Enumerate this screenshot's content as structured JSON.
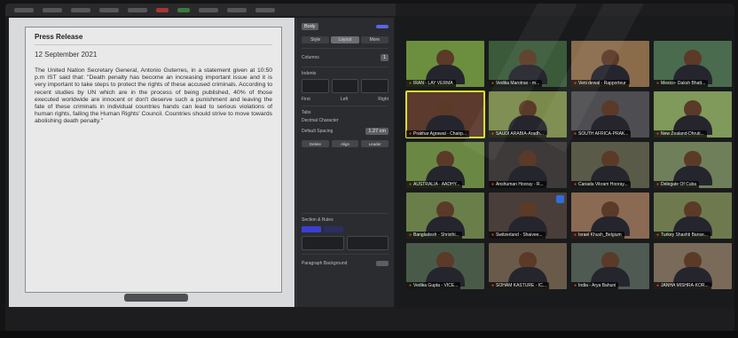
{
  "document": {
    "title": "Press Release",
    "date": "12 September 2021",
    "body": "The United Nation Secretary General, Antonio Guterres, in a statement given at 10:50 p.m IST said that: \"Death penalty has become an increasing important issue and it is very important to take steps to protect the rights of these accused criminals. According to recent studies by UN which are in the process of being published, 40% of those executed worldwide are innocent or don't deserve such a punishment and leaving the fate of these criminals in individual countries hands can lead to serious violations of human rights, failing the Human Rights' Council. Countries should strive to move towards abolishing death penalty.\""
  },
  "inspector": {
    "style_select": "Body",
    "segments": [
      "Style",
      "Layout",
      "More"
    ],
    "sections": {
      "columns": "Columns",
      "columns_value": "1",
      "indents": "Indents",
      "tabs": "Tabs",
      "decimal_character": "Decimal Character",
      "default_spacing": "Default Spacing",
      "default_spacing_value": "1.27 cm",
      "section_borders": "Section & Rules"
    },
    "tab_buttons": [
      "Delete",
      "Align",
      "Leader"
    ],
    "indent_labels": [
      "First",
      "Left",
      "Right"
    ],
    "background": "Paragraph Background"
  },
  "participants": [
    {
      "name": "IRAN - LAY VERMA"
    },
    {
      "name": "Vedika Marotrao - m..."
    },
    {
      "name": "Veni dewal - Rapporteur"
    },
    {
      "name": "Mexico- Daksh Bhatt..."
    },
    {
      "name": "Prakhar Agrawal - Chairp...",
      "active": true
    },
    {
      "name": "SAUDI ARABIA-Aradh..."
    },
    {
      "name": "SOUTH AFRICA-PRAK..."
    },
    {
      "name": "New Zealand-Dhruti..."
    },
    {
      "name": "AUSTRALIA - AADHY..."
    },
    {
      "name": "Anshuman Hooray - R..."
    },
    {
      "name": "Canada Vikram Hooray..."
    },
    {
      "name": "Delegate Of Cuba"
    },
    {
      "name": "Bangladesh - Shristhi..."
    },
    {
      "name": "Switzerland - Shaivee..."
    },
    {
      "name": "Israel Khush_Belgium"
    },
    {
      "name": "Turkey Shashti Banse..."
    },
    {
      "name": "Vedika Gupta - VICE..."
    },
    {
      "name": "SOHAM KASTURE - IC..."
    },
    {
      "name": "India - Arya Bahuni"
    },
    {
      "name": "JANHA MISHRA-KOR..."
    }
  ]
}
